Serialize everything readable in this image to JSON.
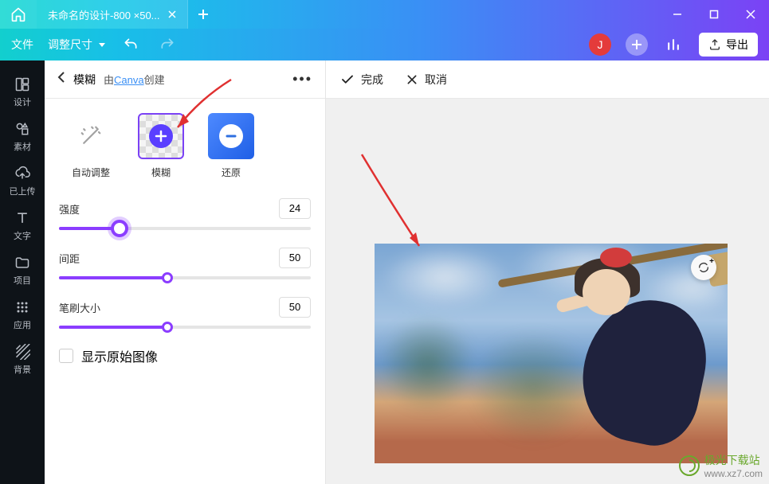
{
  "titlebar": {
    "tab_title": "未命名的设计-800 ×50..."
  },
  "toolbar": {
    "file": "文件",
    "resize": "调整尺寸",
    "avatar_letter": "J",
    "export": "导出"
  },
  "sidebar": {
    "items": [
      {
        "label": "设计"
      },
      {
        "label": "素材"
      },
      {
        "label": "已上传"
      },
      {
        "label": "文字"
      },
      {
        "label": "项目"
      },
      {
        "label": "应用"
      },
      {
        "label": "背景"
      }
    ]
  },
  "panel": {
    "back_title": "模糊",
    "subtitle_prefix": "由",
    "subtitle_link": "Canva",
    "subtitle_suffix": "创建",
    "cards": {
      "auto": "自动调整",
      "blur": "模糊",
      "restore": "还原"
    },
    "sliders": {
      "intensity": {
        "label": "强度",
        "value": "24",
        "pct": 24
      },
      "spacing": {
        "label": "间距",
        "value": "50",
        "pct": 50
      },
      "brush": {
        "label": "笔刷大小",
        "value": "50",
        "pct": 50
      }
    },
    "checkbox_label": "显示原始图像"
  },
  "canvas": {
    "done": "完成",
    "cancel": "取消"
  },
  "watermark": {
    "name": "极光下载站",
    "url": "www.xz7.com"
  }
}
